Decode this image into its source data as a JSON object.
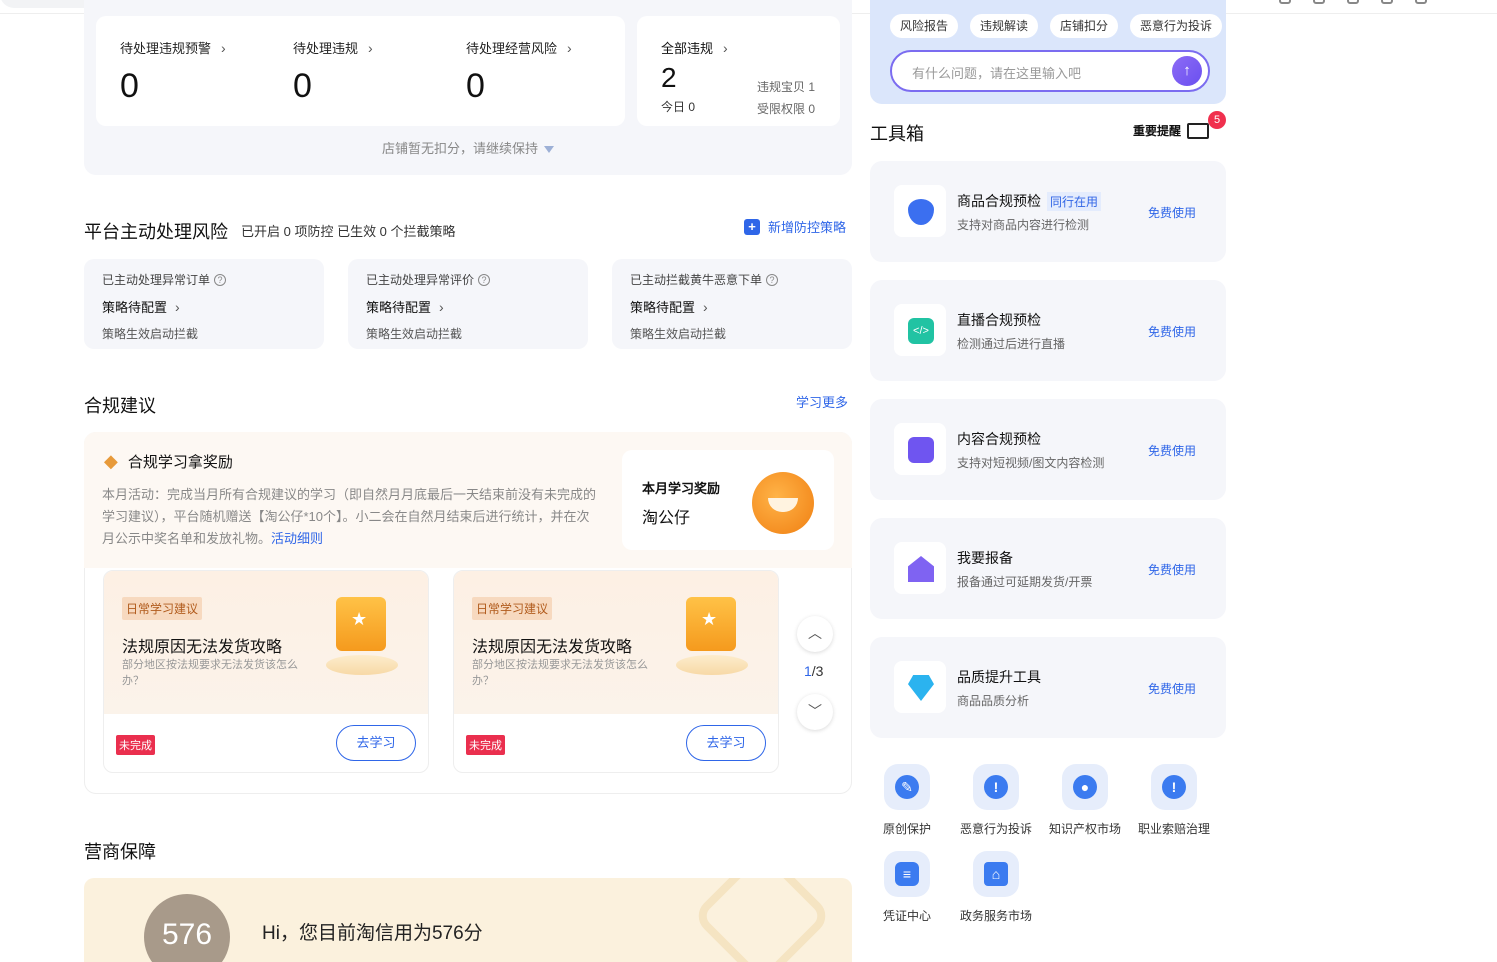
{
  "violations": {
    "items": [
      {
        "label": "待处理违规预警",
        "value": "0"
      },
      {
        "label": "待处理违规",
        "value": "0"
      },
      {
        "label": "待处理经营风险",
        "value": "0"
      }
    ],
    "all": {
      "label": "全部违规",
      "value": "2",
      "today": "今日 0",
      "bei": "违规宝贝 1",
      "limit": "受限权限 0"
    },
    "note": "店铺暂无扣分，请继续保持"
  },
  "risk": {
    "title": "平台主动处理风险",
    "summary": "已开启 0 项防控 已生效 0 个拦截策略",
    "add_label": "新增防控策略",
    "cards": [
      {
        "title": "已主动处理异常订单",
        "status": "策略待配置",
        "desc": "策略生效启动拦截"
      },
      {
        "title": "已主动处理异常评价",
        "status": "策略待配置",
        "desc": "策略生效启动拦截"
      },
      {
        "title": "已主动拦截黄牛恶意下单",
        "status": "策略待配置",
        "desc": "策略生效启动拦截"
      }
    ]
  },
  "compliance": {
    "title": "合规建议",
    "more": "学习更多",
    "reward_title": "合规学习拿奖励",
    "activity": "本月活动：完成当月所有合规建议的学习（即自然月月底最后一天结束前没有未完成的学习建议），平台随机赠送【淘公仔*10个】。小二会在自然月结束后进行统计，并在次月公示中奖名单和发放礼物。",
    "detail_link": "活动细则",
    "award_label": "本月学习奖励",
    "award_name": "淘公仔",
    "lessons": [
      {
        "tag": "日常学习建议",
        "title": "法规原因无法发货攻略",
        "desc": "部分地区按法规要求无法发货该怎么办？",
        "status": "未完成",
        "action": "去学习"
      },
      {
        "tag": "日常学习建议",
        "title": "法规原因无法发货攻略",
        "desc": "部分地区按法规要求无法发货该怎么办？",
        "status": "未完成",
        "action": "去学习"
      }
    ],
    "pager_current": "1",
    "pager_total": "/3"
  },
  "guarantee": {
    "title": "营商保障",
    "score": "576",
    "greeting": "Hi，您目前淘信用为576分"
  },
  "assistant": {
    "chips": [
      "风险报告",
      "违规解读",
      "店铺扣分",
      "恶意行为投诉"
    ],
    "placeholder": "有什么问题，请在这里输入吧"
  },
  "toolbox": {
    "title": "工具箱",
    "reminder_label": "重要提醒",
    "reminder_count": "5",
    "tools": [
      {
        "name": "商品合规预检",
        "badge": "同行在用",
        "desc": "支持对商品内容进行检测",
        "action": "免费使用",
        "color": "#3b6ff0"
      },
      {
        "name": "直播合规预检",
        "badge": "",
        "desc": "检测通过后进行直播",
        "action": "免费使用",
        "color": "#21c3a3"
      },
      {
        "name": "内容合规预检",
        "badge": "",
        "desc": "支持对短视频/图文内容检测",
        "action": "免费使用",
        "color": "#6f55f0"
      },
      {
        "name": "我要报备",
        "badge": "",
        "desc": "报备通过可延期发货/开票",
        "action": "免费使用",
        "color": "#7f63f2"
      },
      {
        "name": "品质提升工具",
        "badge": "",
        "desc": "商品品质分析",
        "action": "免费使用",
        "color": "#2bb3ef"
      }
    ]
  },
  "services": [
    {
      "label": "原创保护",
      "icon": "pen-icon"
    },
    {
      "label": "恶意行为投诉",
      "icon": "alert-icon"
    },
    {
      "label": "知识产权市场",
      "icon": "bulb-icon"
    },
    {
      "label": "职业索赔治理",
      "icon": "alert-icon"
    },
    {
      "label": "凭证中心",
      "icon": "doc-icon"
    },
    {
      "label": "政务服务市场",
      "icon": "building-icon"
    }
  ]
}
